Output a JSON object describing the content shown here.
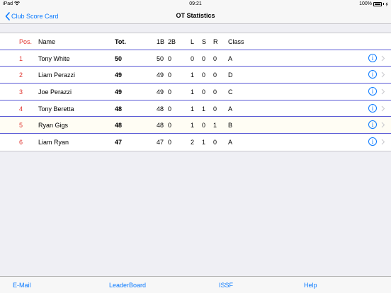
{
  "status": {
    "device": "iPad",
    "time": "09:21",
    "battery": "100%"
  },
  "nav": {
    "back_label": "Club Score Card",
    "title": "OT Statistics"
  },
  "table": {
    "headers": {
      "pos": "Pos.",
      "name": "Name",
      "tot": "Tot.",
      "b1": "1B",
      "b2": "2B",
      "l": "L",
      "s": "S",
      "r": "R",
      "class": "Class"
    },
    "rows": [
      {
        "pos": "1",
        "name": "Tony White",
        "tot": "50",
        "b1": "50",
        "b2": "0",
        "l": "0",
        "s": "0",
        "r": "0",
        "class": "A"
      },
      {
        "pos": "2",
        "name": "Liam Perazzi",
        "tot": "49",
        "b1": "49",
        "b2": "0",
        "l": "1",
        "s": "0",
        "r": "0",
        "class": "D"
      },
      {
        "pos": "3",
        "name": "Joe Perazzi",
        "tot": "49",
        "b1": "49",
        "b2": "0",
        "l": "1",
        "s": "0",
        "r": "0",
        "class": "C"
      },
      {
        "pos": "4",
        "name": "Tony Beretta",
        "tot": "48",
        "b1": "48",
        "b2": "0",
        "l": "1",
        "s": "1",
        "r": "0",
        "class": "A"
      },
      {
        "pos": "5",
        "name": "Ryan Gigs",
        "tot": "48",
        "b1": "48",
        "b2": "0",
        "l": "1",
        "s": "0",
        "r": "1",
        "class": "B"
      },
      {
        "pos": "6",
        "name": "Liam Ryan",
        "tot": "47",
        "b1": "47",
        "b2": "0",
        "l": "2",
        "s": "1",
        "r": "0",
        "class": "A"
      }
    ],
    "info_glyph": "i"
  },
  "tabs": {
    "email": "E-Mail",
    "leaderboard": "LeaderBoard",
    "issf": "ISSF",
    "help": "Help"
  },
  "colors": {
    "accent": "#0a7aff",
    "position": "#e0322d",
    "separator": "#5a5ad6"
  }
}
